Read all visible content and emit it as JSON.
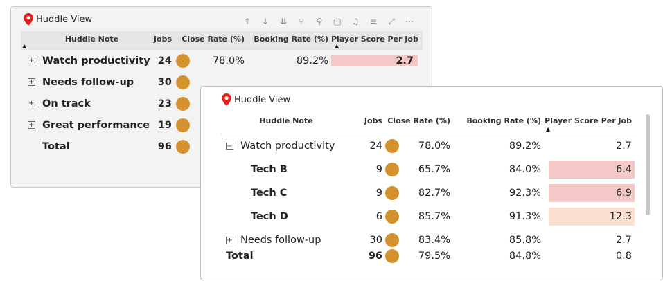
{
  "back": {
    "title": "Huddle View",
    "headers": {
      "note": "Huddle Note",
      "jobs": "Jobs",
      "close": "Close Rate (%)",
      "booking": "Booking Rate (%)",
      "score": "Player Score Per Job"
    },
    "rows": [
      {
        "note": "Watch productivity",
        "jobs": "24",
        "close": "78.0%",
        "booking": "89.2%",
        "score": "2.7"
      },
      {
        "note": "Needs follow-up",
        "jobs": "30"
      },
      {
        "note": "On track",
        "jobs": "23"
      },
      {
        "note": "Great performance",
        "jobs": "19"
      }
    ],
    "total": {
      "note": "Total",
      "jobs": "96"
    }
  },
  "front": {
    "title": "Huddle View",
    "headers": {
      "note": "Huddle Note",
      "jobs": "Jobs",
      "close": "Close Rate (%)",
      "booking": "Booking Rate (%)",
      "score": "Player Score Per Job"
    },
    "group1": {
      "note": "Watch productivity",
      "jobs": "24",
      "close": "78.0%",
      "booking": "89.2%",
      "score": "2.7"
    },
    "subs": [
      {
        "note": "Tech B",
        "jobs": "9",
        "close": "65.7%",
        "booking": "84.0%",
        "score": "6.4"
      },
      {
        "note": "Tech C",
        "jobs": "9",
        "close": "82.7%",
        "booking": "92.3%",
        "score": "6.9"
      },
      {
        "note": "Tech D",
        "jobs": "6",
        "close": "85.7%",
        "booking": "91.3%",
        "score": "12.3"
      }
    ],
    "group2": {
      "note": "Needs follow-up",
      "jobs": "30",
      "close": "83.4%",
      "booking": "85.8%",
      "score": "2.7"
    },
    "total": {
      "note": "Total",
      "jobs": "96",
      "close": "79.5%",
      "booking": "84.8%",
      "score": "0.8"
    }
  },
  "colors": {
    "dot": "#d4922f",
    "pin": "#e0201b",
    "highlight": "#f5c8c8",
    "highlight_light": "#fbe0cf"
  },
  "icons": [
    "sort-ascending-icon",
    "sort-descending-icon",
    "expand-all-icon",
    "drill-down-icon",
    "pin-icon",
    "copy-icon",
    "alert-icon",
    "filter-icon",
    "focus-mode-icon",
    "more-options-icon"
  ]
}
